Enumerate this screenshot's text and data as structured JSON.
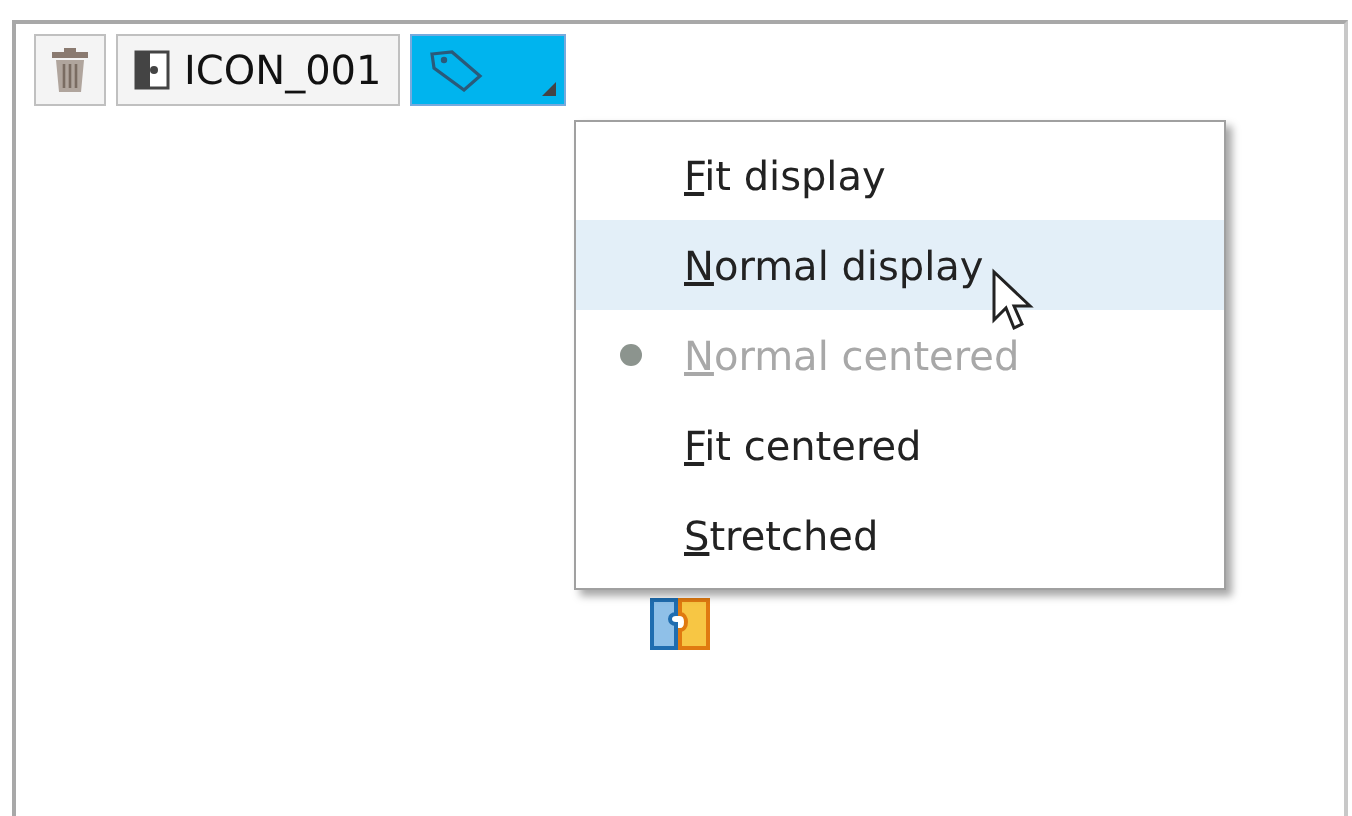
{
  "toolbar": {
    "name_button": "ICON_001",
    "tag_button": {
      "selected": true
    }
  },
  "menu": {
    "items": [
      {
        "label": "Fit display",
        "selected": false,
        "checked": false,
        "disabled": false
      },
      {
        "label": "Normal display",
        "selected": true,
        "checked": false,
        "disabled": false
      },
      {
        "label": "Normal centered",
        "selected": false,
        "checked": true,
        "disabled": true
      },
      {
        "label": "Fit centered",
        "selected": false,
        "checked": false,
        "disabled": false
      },
      {
        "label": "Stretched",
        "selected": false,
        "checked": false,
        "disabled": false
      }
    ]
  }
}
